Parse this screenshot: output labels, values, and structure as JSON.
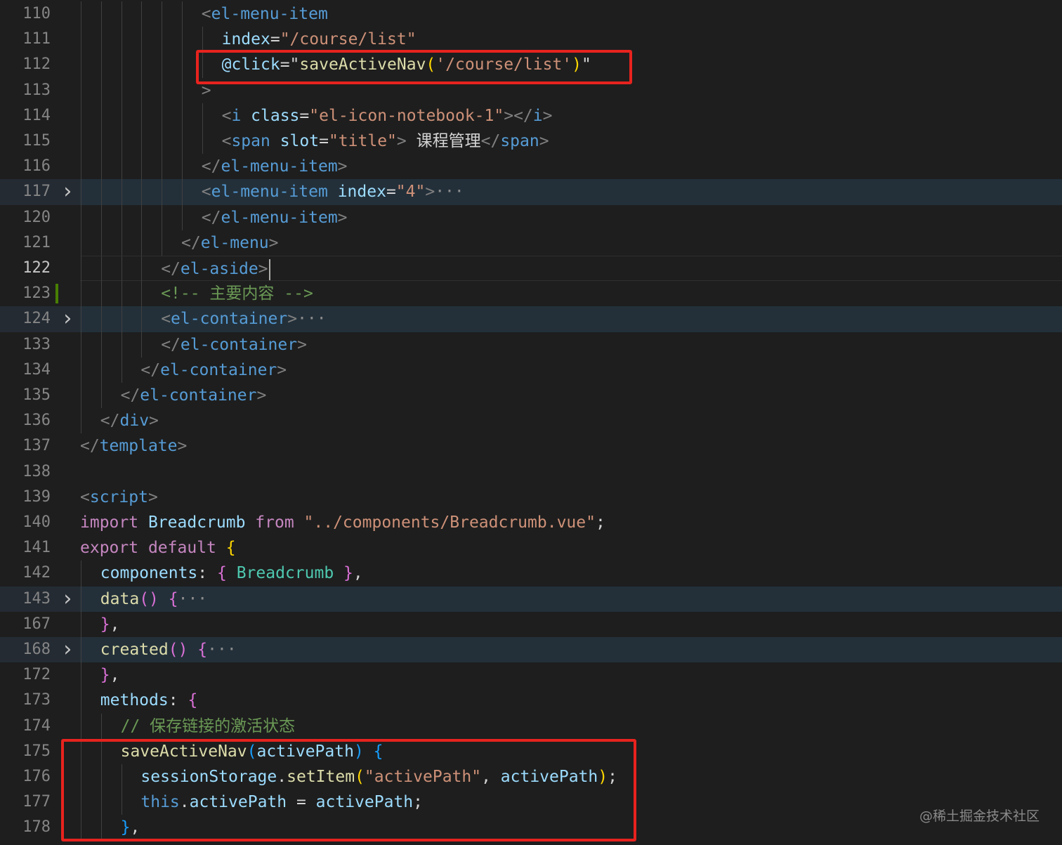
{
  "watermark": "@稀土掘金技术社区",
  "lines": [
    {
      "n": "110",
      "d": 6,
      "tokens": [
        [
          "br",
          "<"
        ],
        [
          "tag",
          "el-menu-item"
        ]
      ]
    },
    {
      "n": "111",
      "d": 7,
      "tokens": [
        [
          "attr",
          "index"
        ],
        [
          "txt",
          "="
        ],
        [
          "str",
          "\"/course/list\""
        ]
      ]
    },
    {
      "n": "112",
      "d": 7,
      "tokens": [
        [
          "attr",
          "@click"
        ],
        [
          "txt",
          "="
        ],
        [
          "txt",
          "\""
        ],
        [
          "fn",
          "saveActiveNav"
        ],
        [
          "b1",
          "("
        ],
        [
          "str",
          "'/course/list'"
        ],
        [
          "b1",
          ")"
        ],
        [
          "txt",
          "\""
        ]
      ]
    },
    {
      "n": "113",
      "d": 6,
      "tokens": [
        [
          "br",
          ">"
        ]
      ]
    },
    {
      "n": "114",
      "d": 7,
      "tokens": [
        [
          "br",
          "<"
        ],
        [
          "tag",
          "i"
        ],
        [
          "txt",
          " "
        ],
        [
          "attr",
          "class"
        ],
        [
          "txt",
          "="
        ],
        [
          "str",
          "\"el-icon-notebook-1\""
        ],
        [
          "br",
          "></"
        ],
        [
          "tag",
          "i"
        ],
        [
          "br",
          ">"
        ]
      ]
    },
    {
      "n": "115",
      "d": 7,
      "tokens": [
        [
          "br",
          "<"
        ],
        [
          "tag",
          "span"
        ],
        [
          "txt",
          " "
        ],
        [
          "attr",
          "slot"
        ],
        [
          "txt",
          "="
        ],
        [
          "str",
          "\"title\""
        ],
        [
          "br",
          ">"
        ],
        [
          "txt",
          " 课程管理"
        ],
        [
          "br",
          "</"
        ],
        [
          "tag",
          "span"
        ],
        [
          "br",
          ">"
        ]
      ]
    },
    {
      "n": "116",
      "d": 6,
      "tokens": [
        [
          "br",
          "</"
        ],
        [
          "tag",
          "el-menu-item"
        ],
        [
          "br",
          ">"
        ]
      ]
    },
    {
      "n": "117",
      "d": 6,
      "fold": true,
      "tokens": [
        [
          "br",
          "<"
        ],
        [
          "tag",
          "el-menu-item"
        ],
        [
          "txt",
          " "
        ],
        [
          "attr",
          "index"
        ],
        [
          "txt",
          "="
        ],
        [
          "str",
          "\"4\""
        ],
        [
          "br",
          ">"
        ],
        [
          "ell",
          "···"
        ]
      ]
    },
    {
      "n": "120",
      "d": 6,
      "tokens": [
        [
          "br",
          "</"
        ],
        [
          "tag",
          "el-menu-item"
        ],
        [
          "br",
          ">"
        ]
      ]
    },
    {
      "n": "121",
      "d": 5,
      "tokens": [
        [
          "br",
          "</"
        ],
        [
          "tag",
          "el-menu"
        ],
        [
          "br",
          ">"
        ]
      ]
    },
    {
      "n": "122",
      "d": 4,
      "current": true,
      "cursor": true,
      "tokens": [
        [
          "br",
          "</"
        ],
        [
          "tag",
          "el-aside"
        ],
        [
          "br",
          ">"
        ]
      ]
    },
    {
      "n": "123",
      "d": 4,
      "git": true,
      "tokens": [
        [
          "cmt",
          "<!-- 主要内容 -->"
        ]
      ]
    },
    {
      "n": "124",
      "d": 4,
      "fold": true,
      "tokens": [
        [
          "br",
          "<"
        ],
        [
          "tag",
          "el-container"
        ],
        [
          "br",
          ">"
        ],
        [
          "ell",
          "···"
        ]
      ]
    },
    {
      "n": "133",
      "d": 4,
      "tokens": [
        [
          "br",
          "</"
        ],
        [
          "tag",
          "el-container"
        ],
        [
          "br",
          ">"
        ]
      ]
    },
    {
      "n": "134",
      "d": 3,
      "tokens": [
        [
          "br",
          "</"
        ],
        [
          "tag",
          "el-container"
        ],
        [
          "br",
          ">"
        ]
      ]
    },
    {
      "n": "135",
      "d": 2,
      "tokens": [
        [
          "br",
          "</"
        ],
        [
          "tag",
          "el-container"
        ],
        [
          "br",
          ">"
        ]
      ]
    },
    {
      "n": "136",
      "d": 1,
      "tokens": [
        [
          "br",
          "</"
        ],
        [
          "tag",
          "div"
        ],
        [
          "br",
          ">"
        ]
      ]
    },
    {
      "n": "137",
      "d": 0,
      "tokens": [
        [
          "br",
          "</"
        ],
        [
          "tag",
          "template"
        ],
        [
          "br",
          ">"
        ]
      ]
    },
    {
      "n": "138",
      "d": 0,
      "tokens": []
    },
    {
      "n": "139",
      "d": 0,
      "tokens": [
        [
          "br",
          "<"
        ],
        [
          "tag",
          "script"
        ],
        [
          "br",
          ">"
        ]
      ]
    },
    {
      "n": "140",
      "d": 0,
      "tokens": [
        [
          "kw",
          "import"
        ],
        [
          "txt",
          " "
        ],
        [
          "var",
          "Breadcrumb"
        ],
        [
          "txt",
          " "
        ],
        [
          "kw",
          "from"
        ],
        [
          "txt",
          " "
        ],
        [
          "str",
          "\"../components/Breadcrumb.vue\""
        ],
        [
          "txt",
          ";"
        ]
      ]
    },
    {
      "n": "141",
      "d": 0,
      "tokens": [
        [
          "kw",
          "export"
        ],
        [
          "txt",
          " "
        ],
        [
          "kw",
          "default"
        ],
        [
          "txt",
          " "
        ],
        [
          "b1",
          "{"
        ]
      ]
    },
    {
      "n": "142",
      "d": 1,
      "tokens": [
        [
          "var",
          "components"
        ],
        [
          "txt",
          ": "
        ],
        [
          "b2",
          "{"
        ],
        [
          "txt",
          " "
        ],
        [
          "cls",
          "Breadcrumb"
        ],
        [
          "txt",
          " "
        ],
        [
          "b2",
          "}"
        ],
        [
          "txt",
          ","
        ]
      ]
    },
    {
      "n": "143",
      "d": 1,
      "fold": true,
      "tokens": [
        [
          "fn",
          "data"
        ],
        [
          "b2",
          "()"
        ],
        [
          "txt",
          " "
        ],
        [
          "b2",
          "{"
        ],
        [
          "ell",
          "···"
        ]
      ]
    },
    {
      "n": "167",
      "d": 1,
      "tokens": [
        [
          "b2",
          "}"
        ],
        [
          "txt",
          ","
        ]
      ]
    },
    {
      "n": "168",
      "d": 1,
      "fold": true,
      "tokens": [
        [
          "fn",
          "created"
        ],
        [
          "b2",
          "()"
        ],
        [
          "txt",
          " "
        ],
        [
          "b2",
          "{"
        ],
        [
          "ell",
          "···"
        ]
      ]
    },
    {
      "n": "172",
      "d": 1,
      "tokens": [
        [
          "b2",
          "}"
        ],
        [
          "txt",
          ","
        ]
      ]
    },
    {
      "n": "173",
      "d": 1,
      "tokens": [
        [
          "var",
          "methods"
        ],
        [
          "txt",
          ": "
        ],
        [
          "b2",
          "{"
        ]
      ]
    },
    {
      "n": "174",
      "d": 2,
      "tokens": [
        [
          "cmt",
          "// 保存链接的激活状态"
        ]
      ]
    },
    {
      "n": "175",
      "d": 2,
      "tokens": [
        [
          "fn",
          "saveActiveNav"
        ],
        [
          "b3",
          "("
        ],
        [
          "var",
          "activePath"
        ],
        [
          "b3",
          ")"
        ],
        [
          "txt",
          " "
        ],
        [
          "b3",
          "{"
        ]
      ]
    },
    {
      "n": "176",
      "d": 3,
      "tokens": [
        [
          "var",
          "sessionStorage"
        ],
        [
          "txt",
          "."
        ],
        [
          "fn",
          "setItem"
        ],
        [
          "b1",
          "("
        ],
        [
          "str",
          "\"activePath\""
        ],
        [
          "txt",
          ", "
        ],
        [
          "var",
          "activePath"
        ],
        [
          "b1",
          ")"
        ],
        [
          "txt",
          ";"
        ]
      ]
    },
    {
      "n": "177",
      "d": 3,
      "tokens": [
        [
          "kw2",
          "this"
        ],
        [
          "txt",
          "."
        ],
        [
          "var",
          "activePath"
        ],
        [
          "txt",
          " = "
        ],
        [
          "var",
          "activePath"
        ],
        [
          "txt",
          ";"
        ]
      ]
    },
    {
      "n": "178",
      "d": 2,
      "tokens": [
        [
          "b3",
          "}"
        ],
        [
          "txt",
          ","
        ]
      ]
    }
  ],
  "colors": {
    "background": "#1e1e1e",
    "highlight_box": "#e8231e",
    "tag": "#569cd6",
    "string": "#ce9178",
    "attribute": "#9cdcfe",
    "comment": "#6a9955",
    "keyword": "#c586c0",
    "function": "#dcdcaa"
  },
  "icons": {
    "fold_marker": "chevron-right-icon",
    "fold_ellipsis": "ellipsis-icon"
  }
}
